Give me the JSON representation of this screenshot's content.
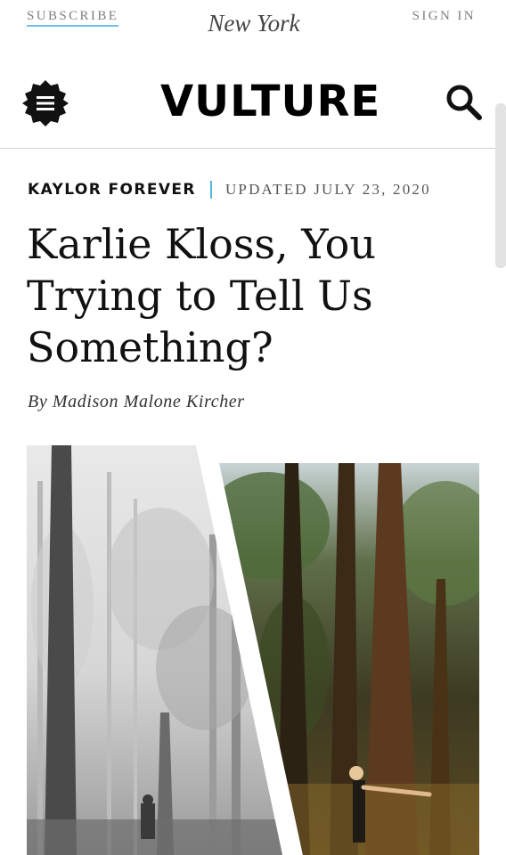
{
  "topbar": {
    "subscribe_label": "SUBSCRIBE",
    "sign_in_label": "SIGN IN",
    "publisher_logo": "New York"
  },
  "header": {
    "logo_text": "VULTURE",
    "menu_icon": "menu-icon",
    "search_icon": "search-icon"
  },
  "article": {
    "rubric": "KAYLOR FOREVER",
    "updated": "UPDATED JULY 23, 2020",
    "headline": "Karlie Kloss, You Trying to Tell Us Something?",
    "byline": "By Madison Malone Kircher"
  },
  "colors": {
    "accent": "#56b7dd",
    "subscribe_underline": "#6fc3e6",
    "text": "#111111",
    "muted": "#7f7f7f"
  }
}
